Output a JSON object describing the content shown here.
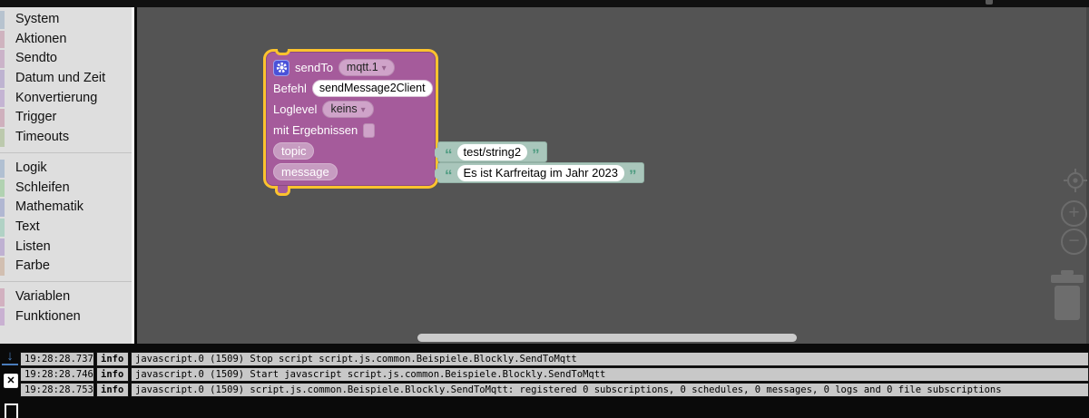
{
  "colors": {
    "workspace_bg": "#545454",
    "block_purple": "#a55b9b",
    "selection_gold": "#fcc32e",
    "string_block_teal": "#a9c6bb",
    "gear_blue": "#4a52d9",
    "log_row_bg": "#c8c8c8",
    "log_download_blue": "#4a7dbb"
  },
  "icons": {
    "dropdown_arrow": "▾",
    "open_quote": "“",
    "close_quote": "”",
    "download_arrow": "↓",
    "clear_x": "✕",
    "zoom_in": "+",
    "zoom_out": "−"
  },
  "sidebar": {
    "items": [
      {
        "label": "System",
        "color": "#b7c3cf"
      },
      {
        "label": "Aktionen",
        "color": "#cfb3bf"
      },
      {
        "label": "Sendto",
        "color": "#cbb3c9"
      },
      {
        "label": "Datum und Zeit",
        "color": "#beb3d1"
      },
      {
        "label": "Konvertierung",
        "color": "#c4b4d3"
      },
      {
        "label": "Trigger",
        "color": "#cfb0bd"
      },
      {
        "label": "Timeouts",
        "color": "#bcc9ad"
      },
      {
        "label": "Logik",
        "color": "#b1c0d2"
      },
      {
        "label": "Schleifen",
        "color": "#b1d2b1"
      },
      {
        "label": "Mathematik",
        "color": "#b1b7d2"
      },
      {
        "label": "Text",
        "color": "#b1d2c5"
      },
      {
        "label": "Listen",
        "color": "#bfb1d2"
      },
      {
        "label": "Farbe",
        "color": "#d2bfb1"
      },
      {
        "label": "Variablen",
        "color": "#d2b1c0"
      },
      {
        "label": "Funktionen",
        "color": "#c9b1d2"
      }
    ]
  },
  "block": {
    "header_label": "sendTo",
    "instance_value": "mqtt.1",
    "befehl_label": "Befehl",
    "befehl_value": "sendMessage2Client",
    "loglevel_label": "Loglevel",
    "loglevel_value": "keins",
    "results_label": "mit Ergebnissen",
    "topic_label": "topic",
    "message_label": "message"
  },
  "text_blocks": [
    {
      "value": "test/string2"
    },
    {
      "value": "Es ist Karfreitag im Jahr 2023"
    }
  ],
  "log": {
    "rows": [
      {
        "time": "19:28:28.737",
        "level": "info",
        "msg": "javascript.0 (1509) Stop script script.js.common.Beispiele.Blockly.SendToMqtt"
      },
      {
        "time": "19:28:28.746",
        "level": "info",
        "msg": "javascript.0 (1509) Start javascript script.js.common.Beispiele.Blockly.SendToMqtt"
      },
      {
        "time": "19:28:28.753",
        "level": "info",
        "msg": "javascript.0 (1509) script.js.common.Beispiele.Blockly.SendToMqtt: registered 0 subscriptions, 0 schedules, 0 messages, 0 logs and 0 file subscriptions"
      }
    ]
  }
}
